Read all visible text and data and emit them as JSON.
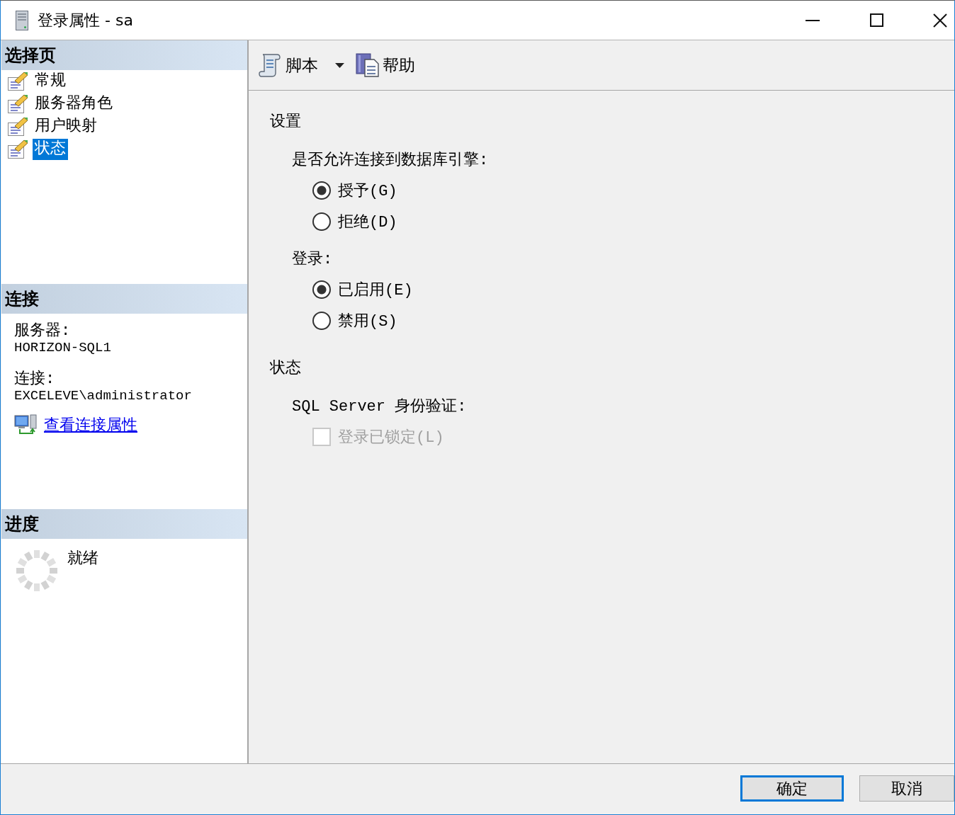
{
  "window": {
    "title": "登录属性 - sa"
  },
  "sidebar": {
    "pages_header": "选择页",
    "pages": [
      {
        "label": "常规",
        "selected": false
      },
      {
        "label": "服务器角色",
        "selected": false
      },
      {
        "label": "用户映射",
        "selected": false
      },
      {
        "label": "状态",
        "selected": true
      }
    ],
    "connection": {
      "header": "连接",
      "fields": [
        {
          "label": "服务器:",
          "value": "HORIZON-SQL1"
        },
        {
          "label": "连接:",
          "value": "EXCELEVE\\administrator"
        }
      ],
      "link": "查看连接属性"
    },
    "progress": {
      "header": "进度",
      "status": "就绪"
    }
  },
  "toolbar": {
    "items": [
      {
        "kind": "dropdown",
        "label": "脚本"
      },
      {
        "kind": "button",
        "label": "帮助"
      }
    ]
  },
  "content": {
    "sections": [
      {
        "title": "设置",
        "groups": [
          {
            "kind": "radio",
            "label": "是否允许连接到数据库引擎:",
            "options": [
              {
                "label": "授予(G)",
                "selected": true
              },
              {
                "label": "拒绝(D)",
                "selected": false
              }
            ]
          },
          {
            "kind": "radio",
            "label": "登录:",
            "options": [
              {
                "label": "已启用(E)",
                "selected": true
              },
              {
                "label": "禁用(S)",
                "selected": false
              }
            ]
          }
        ]
      },
      {
        "title": "状态",
        "groups": [
          {
            "kind": "checkbox",
            "label": "SQL Server 身份验证:",
            "options": [
              {
                "label": "登录已锁定(L)",
                "checked": false,
                "disabled": true
              }
            ]
          }
        ]
      }
    ]
  },
  "buttons": [
    {
      "label": "确定",
      "default": true
    },
    {
      "label": "取消",
      "default": false
    }
  ]
}
